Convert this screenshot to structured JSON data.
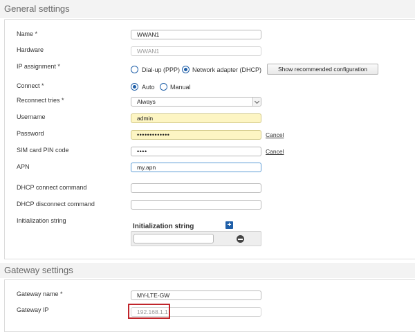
{
  "general": {
    "title": "General settings",
    "name_label": "Name *",
    "name_value": "WWAN1",
    "hardware_label": "Hardware",
    "hardware_value": "WWAN1",
    "ip_assignment_label": "IP assignment *",
    "ip_option_dialup": "Dial-up (PPP)",
    "ip_option_network": "Network adapter (DHCP)",
    "ip_selected": "Network adapter (DHCP)",
    "show_recommended_label": "Show recommended configuration",
    "connect_label": "Connect *",
    "connect_option_auto": "Auto",
    "connect_option_manual": "Manual",
    "connect_selected": "Auto",
    "reconnect_label": "Reconnect tries *",
    "reconnect_value": "Always",
    "username_label": "Username",
    "username_value": "admin",
    "password_label": "Password",
    "password_value": "•••••••••••••",
    "password_cancel": "Cancel",
    "sim_pin_label": "SIM card PIN code",
    "sim_pin_value": "••••",
    "sim_pin_cancel": "Cancel",
    "apn_label": "APN",
    "apn_value": "my.apn",
    "dhcp_connect_label": "DHCP connect command",
    "dhcp_connect_value": "",
    "dhcp_disconnect_label": "DHCP disconnect command",
    "dhcp_disconnect_value": "",
    "init_string_label": "Initialization string",
    "init_table_header": "Initialization string",
    "init_row_value": ""
  },
  "gateway": {
    "title": "Gateway settings",
    "name_label": "Gateway name *",
    "name_value": "MY-LTE-GW",
    "ip_label": "Gateway IP",
    "ip_value": "192.168.1.1"
  },
  "colors": {
    "accent": "#1f5fa8",
    "highlight": "#c0252b",
    "autofill": "#fdf5c3"
  }
}
